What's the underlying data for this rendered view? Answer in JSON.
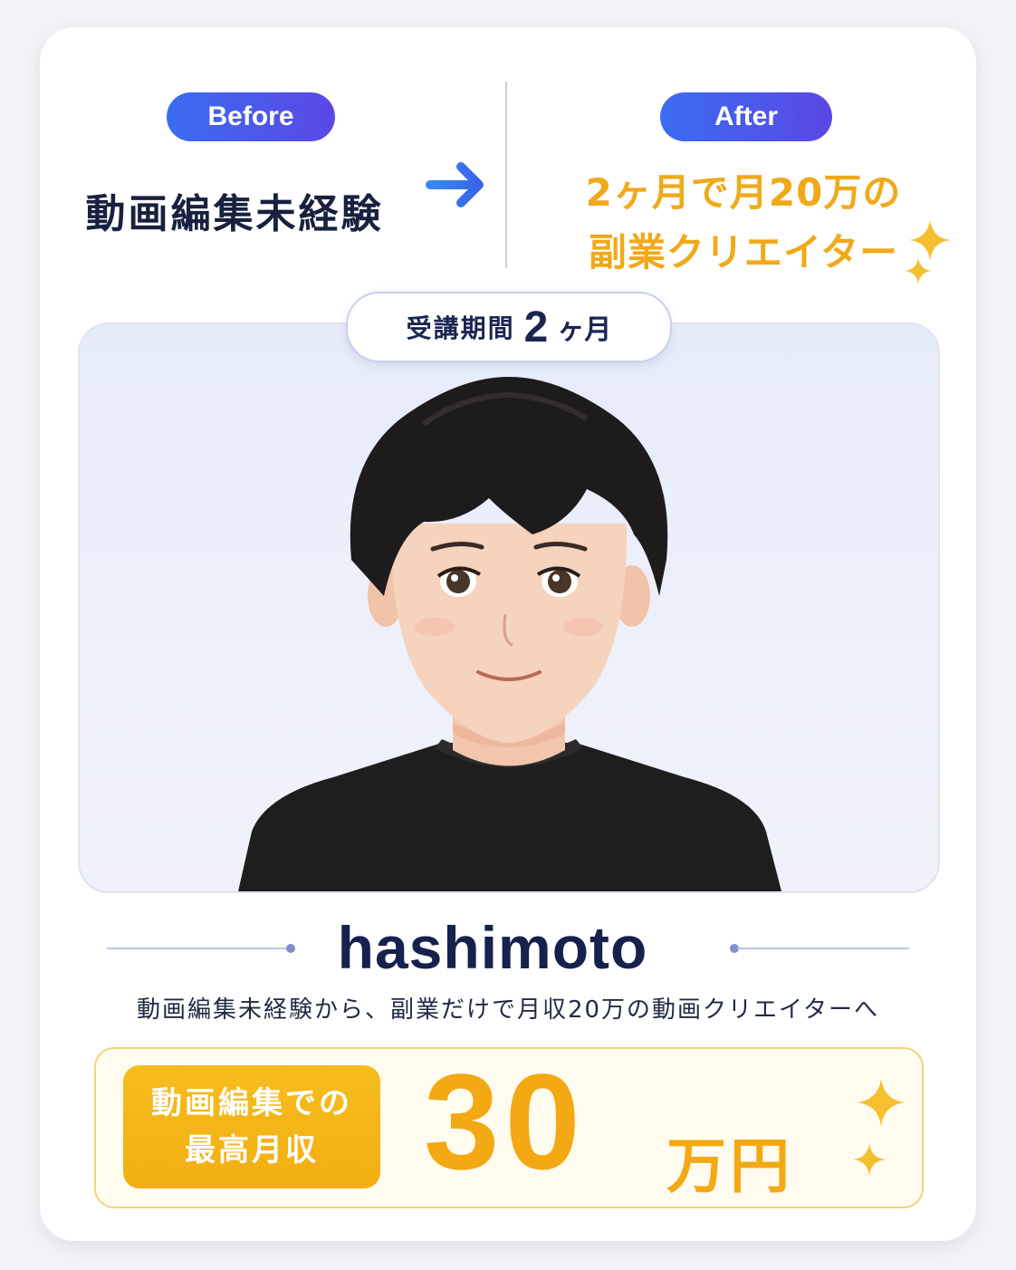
{
  "before": {
    "badge": "Before",
    "text": "動画編集未経験"
  },
  "after": {
    "badge": "After",
    "line1": "2ヶ月で月20万の",
    "line2": "副業クリエイター"
  },
  "period": {
    "label": "受講期間",
    "value": "2",
    "unit": "ヶ月"
  },
  "profile": {
    "name": "hashimoto",
    "description": "動画編集未経験から、副業だけで月収20万の動画クリエイターへ"
  },
  "income": {
    "label_line1": "動画編集での",
    "label_line2": "最高月収",
    "value": "30",
    "unit": "万円"
  },
  "icons": [
    "arrow-right-icon",
    "sparkle-icon"
  ],
  "colors": {
    "accent_blue": "#3a6df0",
    "accent_gold": "#f2a913",
    "text_navy": "#16214d"
  }
}
